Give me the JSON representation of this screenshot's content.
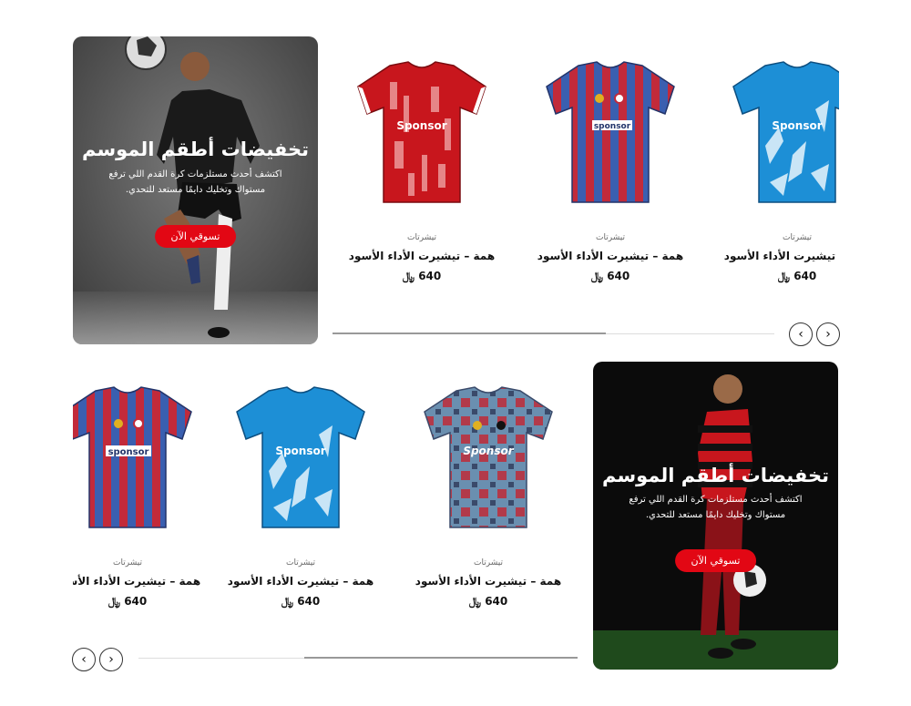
{
  "colors": {
    "accent": "#e20714",
    "text": "#111111",
    "muted": "#666666"
  },
  "promo_top": {
    "title": "تخفيضات أطقم الموسم",
    "description": "اكتشف أحدث مستلزمات كرة القدم اللي ترفع مستواك وتخليك دايمًا مستعد للتحدي.",
    "button": "تسوقي الآن"
  },
  "promo_bottom": {
    "title": "تخفيضات أطقم الموسم",
    "description": "اكتشف أحدث مستلزمات كرة القدم اللي ترفع مستواك وتخليك دايمًا مستعد للتحدي.",
    "button": "تسوقي الآن"
  },
  "row1": [
    {
      "category": "تيشرتات",
      "name": "همة – تيشيرت الأداء الأسود",
      "price": "640 ﷼",
      "jersey": "red-white",
      "sponsor": "Sponsor"
    },
    {
      "category": "تيشرتات",
      "name": "همة – تيشيرت الأداء الأسود",
      "price": "640 ﷼",
      "jersey": "blue-red-stripes",
      "sponsor": "sponsor"
    },
    {
      "category": "تيشرتات",
      "name": "همة – تيشيرت الأداء الأسود",
      "price": "640 ﷼",
      "jersey": "sky-blue",
      "sponsor": "Sponsor"
    }
  ],
  "row2": [
    {
      "category": "تيشرتات",
      "name": "همة – تيشيرت الأداء الأسود",
      "price": "640 ﷼",
      "jersey": "blue-red-stripes",
      "sponsor": "sponsor"
    },
    {
      "category": "تيشرتات",
      "name": "همة – تيشيرت الأداء الأسود",
      "price": "640 ﷼",
      "jersey": "sky-blue",
      "sponsor": "Sponsor"
    },
    {
      "category": "تيشرتات",
      "name": "همة – تيشيرت الأداء الأسود",
      "price": "640 ﷼",
      "jersey": "grey-red",
      "sponsor": "Sponsor"
    }
  ],
  "icons": {
    "prev": "chevron-left-icon",
    "next": "chevron-right-icon"
  }
}
